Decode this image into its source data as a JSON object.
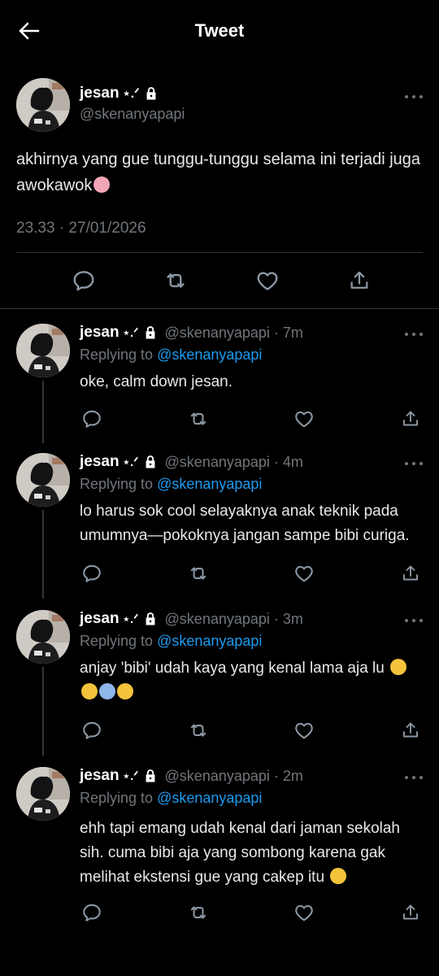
{
  "header": {
    "title": "Tweet"
  },
  "main_tweet": {
    "name": "jesan",
    "name_suffix": "⋆.ᐟ",
    "handle": "@skenanyapapi",
    "text": "akhirnya yang gue tunggu-tunggu selama ini terjadi juga awokawok",
    "timestamp": "23.33 · 27/01/2026"
  },
  "replies": [
    {
      "name": "jesan",
      "name_suffix": "⋆.ᐟ",
      "handle_time": "@skenanyapapi · 7m",
      "replying_label": "Replying to ",
      "replying_to": "@skenanyapapi",
      "text": "oke, calm down jesan."
    },
    {
      "name": "jesan",
      "name_suffix": "⋆.ᐟ",
      "handle_time": "@skenanyapapi · 4m",
      "replying_label": "Replying to ",
      "replying_to": "@skenanyapapi",
      "text": "lo harus sok cool selayaknya anak teknik pada umumnya—pokoknya jangan sampe bibi curiga."
    },
    {
      "name": "jesan",
      "name_suffix": "⋆.ᐟ",
      "handle_time": "@skenanyapapi · 3m",
      "replying_label": "Replying to ",
      "replying_to": "@skenanyapapi",
      "text": "anjay 'bibi' udah kaya yang kenal lama aja lu"
    },
    {
      "name": "jesan",
      "name_suffix": "⋆.ᐟ",
      "handle_time": "@skenanyapapi · 2m",
      "replying_label": "Replying to ",
      "replying_to": "@skenanyapapi",
      "text": "ehh tapi emang udah kenal dari jaman sekolah sih. cuma bibi aja yang sombong karena gak melihat ekstensi gue yang cakep itu"
    }
  ],
  "icons": {
    "back": "arrow-left-icon",
    "reply": "comment-icon",
    "retweet": "retweet-icon",
    "like": "heart-icon",
    "share": "share-icon",
    "lock": "lock-icon",
    "more": "more-icon"
  },
  "colors": {
    "background": "#000000",
    "text": "#e7e9ea",
    "muted": "#71767b",
    "link": "#1d9bf0",
    "border": "#2f3336"
  }
}
